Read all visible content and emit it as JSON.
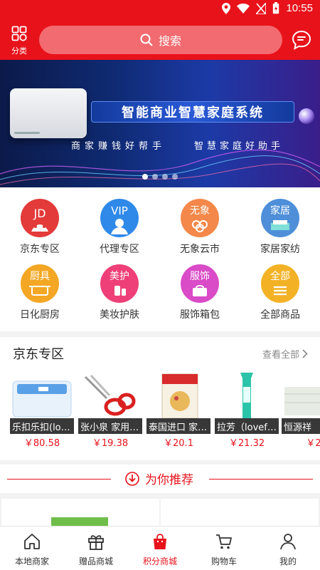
{
  "status_bar": {
    "time": "10:55",
    "icons": [
      "location-icon",
      "wifi-icon",
      "no-signal-icon",
      "battery-icon"
    ]
  },
  "header": {
    "category_label": "分类",
    "search_placeholder": "搜索"
  },
  "banner": {
    "title": "智能商业智慧家庭系统",
    "subtitle_left": "商家赚钱好帮手",
    "subtitle_right": "智慧家庭好助手",
    "slide_count": 4,
    "active_slide": 1
  },
  "categories": [
    {
      "label": "京东专区",
      "icon_text": "JD",
      "color": "#e33a3a"
    },
    {
      "label": "代理专区",
      "icon_text": "VIP",
      "color": "#2f89e8"
    },
    {
      "label": "无象云市",
      "icon_text": "无象",
      "color": "#f3884a"
    },
    {
      "label": "家居家纺",
      "icon_text": "家居",
      "color": "#4f8fd9"
    },
    {
      "label": "日化厨房",
      "icon_text": "厨具",
      "color": "#f3a724"
    },
    {
      "label": "美妆护肤",
      "icon_text": "美护",
      "color": "#ee3f78"
    },
    {
      "label": "服饰箱包",
      "icon_text": "服饰",
      "color": "#d94bc7"
    },
    {
      "label": "全部商品",
      "icon_text": "全部",
      "color": "#f3b226"
    }
  ],
  "jd_section": {
    "title": "京东专区",
    "more_label": "查看全部",
    "products": [
      {
        "name": "乐扣乐扣(lo…",
        "price": "￥80.58"
      },
      {
        "name": "张小泉 家用…",
        "price": "￥19.38"
      },
      {
        "name": "泰国进口 家…",
        "price": "￥20.1"
      },
      {
        "name": "拉芳（lovef…",
        "price": "￥21.32"
      },
      {
        "name": "恒源祥",
        "price": "￥2"
      }
    ]
  },
  "recommend": {
    "title": "为你推荐"
  },
  "tabbar": {
    "active": 2,
    "tabs": [
      {
        "label": "本地商家"
      },
      {
        "label": "赠品商城"
      },
      {
        "label": "积分商城"
      },
      {
        "label": "购物车"
      },
      {
        "label": "我的"
      }
    ]
  },
  "colors": {
    "brand": "#e8121b",
    "price": "#e8121b"
  }
}
